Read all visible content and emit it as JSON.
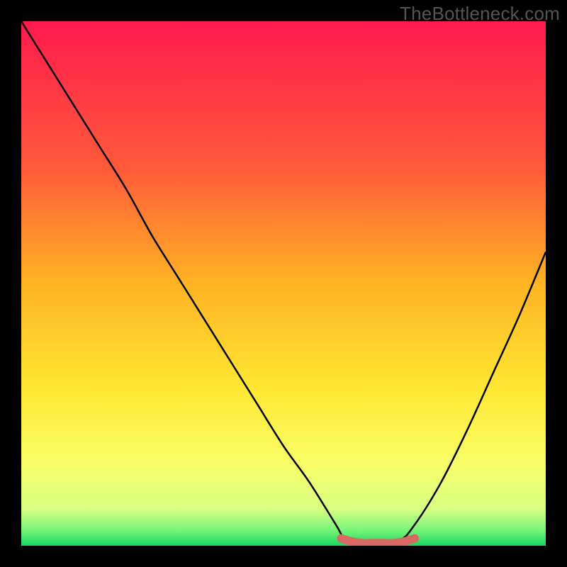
{
  "watermark": {
    "text": "TheBottleneck.com"
  },
  "chart_data": {
    "type": "line",
    "title": "",
    "xlabel": "",
    "ylabel": "",
    "xlim": [
      0,
      100
    ],
    "ylim": [
      0,
      100
    ],
    "series": [
      {
        "name": "bottleneck-curve",
        "x": [
          0,
          5,
          10,
          15,
          20,
          25,
          30,
          35,
          40,
          45,
          50,
          55,
          60,
          62,
          66,
          72,
          75,
          80,
          85,
          90,
          95,
          100
        ],
        "values": [
          100,
          92,
          84,
          76,
          68,
          59,
          51,
          43,
          35,
          27,
          19,
          12,
          4,
          1,
          0,
          1,
          4,
          12,
          22,
          33,
          44,
          56
        ]
      },
      {
        "name": "optimal-marker",
        "x": [
          61,
          63,
          65,
          67,
          69,
          71,
          73,
          75
        ],
        "values": [
          1.4,
          0.8,
          0.5,
          0.5,
          0.5,
          0.5,
          0.8,
          1.4
        ]
      }
    ],
    "gradient_stops": [
      {
        "pct": 0,
        "color": "#ff1a4e"
      },
      {
        "pct": 28,
        "color": "#ff5a3a"
      },
      {
        "pct": 50,
        "color": "#ffb324"
      },
      {
        "pct": 70,
        "color": "#ffe733"
      },
      {
        "pct": 85,
        "color": "#f8ff6b"
      },
      {
        "pct": 93,
        "color": "#d8ff82"
      },
      {
        "pct": 97,
        "color": "#78f57a"
      },
      {
        "pct": 100,
        "color": "#19d65e"
      }
    ],
    "marker_color": "#d66a63",
    "curve_color": "#000000"
  }
}
